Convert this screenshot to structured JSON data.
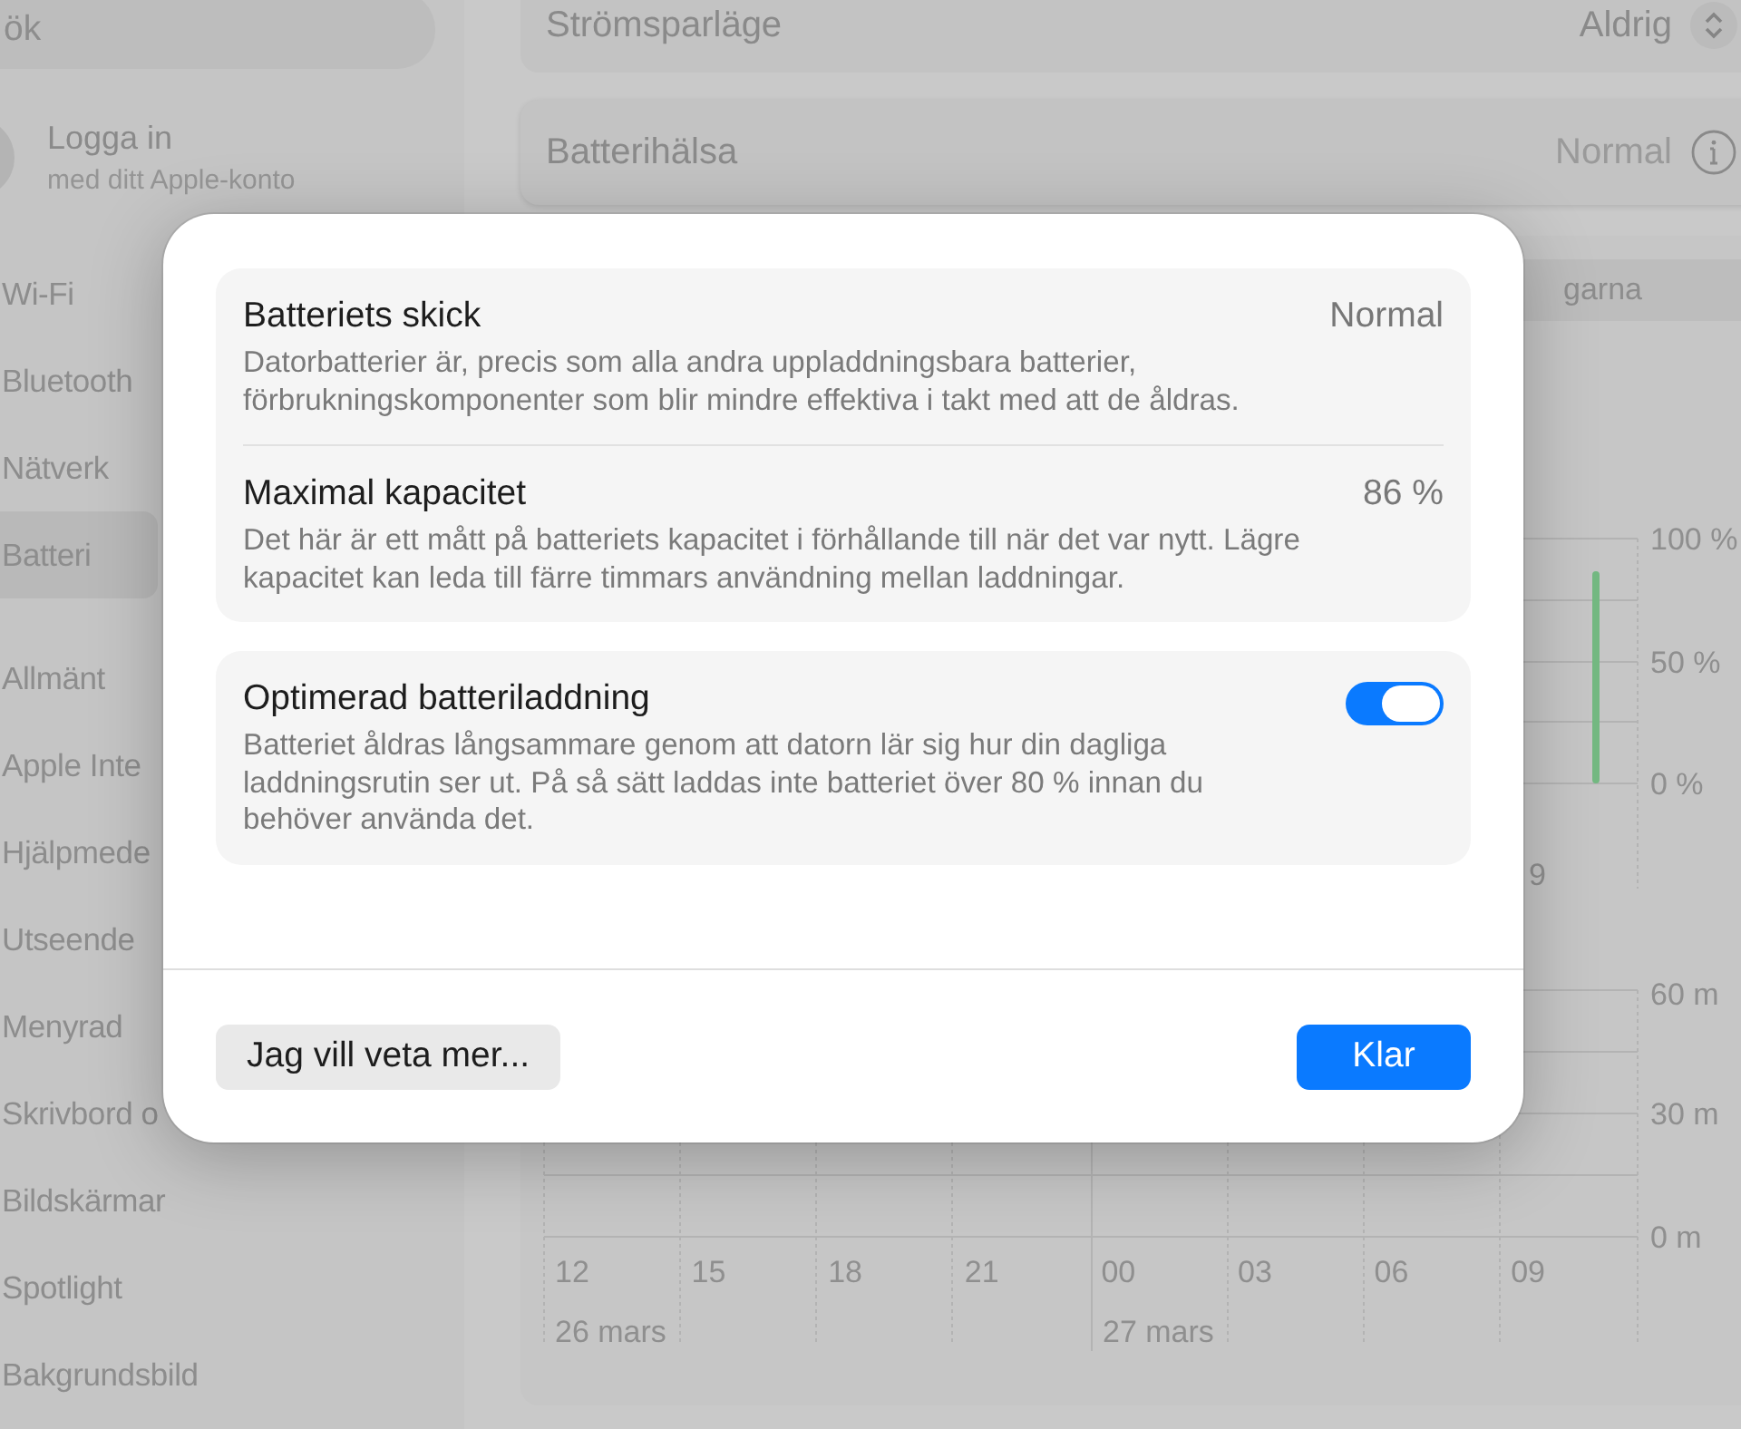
{
  "sidebar": {
    "search": {
      "placeholder": "ök"
    },
    "account": {
      "title": "Logga in",
      "subtitle": "med ditt Apple-konto"
    },
    "groups": [
      [
        {
          "label": "Wi-Fi",
          "selected": false
        },
        {
          "label": "Bluetooth",
          "selected": false
        },
        {
          "label": "Nätverk",
          "selected": false
        },
        {
          "label": "Batteri",
          "selected": true
        }
      ],
      [
        {
          "label": "Allmänt",
          "selected": false
        },
        {
          "label": "Apple Inte",
          "selected": false
        },
        {
          "label": "Hjälpmede",
          "selected": false
        },
        {
          "label": "Utseende",
          "selected": false
        },
        {
          "label": "Menyrad",
          "selected": false
        },
        {
          "label": "Skrivbord o",
          "selected": false
        },
        {
          "label": "Bildskärmar",
          "selected": false
        },
        {
          "label": "Spotlight",
          "selected": false
        },
        {
          "label": "Bakgrundsbild",
          "selected": false
        }
      ]
    ]
  },
  "main": {
    "rows": [
      {
        "label": "Strömsparläge",
        "value": "Aldrig",
        "kind": "popup"
      },
      {
        "label": "Batterihälsa",
        "value": "Normal",
        "kind": "info"
      }
    ],
    "segment": {
      "label": "garna"
    },
    "charts": [
      {
        "y_ticks": [
          "100 %",
          "50 %",
          "0 %"
        ],
        "x_labels": [
          "9"
        ]
      },
      {
        "y_ticks": [
          "60 m",
          "30 m",
          "0 m"
        ],
        "x_labels": [
          "12",
          "15",
          "18",
          "21",
          "00",
          "03",
          "06",
          "09"
        ],
        "dates": [
          "26 mars",
          "27 mars"
        ]
      }
    ]
  },
  "dialog": {
    "cards": [
      {
        "items": [
          {
            "kind": "value",
            "title": "Batteriets skick",
            "value": "Normal",
            "description": "Datorbatterier är, precis som alla andra uppladdningsbara batterier, förbrukningskomponenter som blir mindre effektiva i takt med att de åldras."
          },
          {
            "kind": "value",
            "title": "Maximal kapacitet",
            "value": "86 %",
            "description": "Det här är ett mått på batteriets kapacitet i förhållande till när det var nytt. Lägre kapacitet kan leda till färre timmars användning mellan laddningar."
          }
        ]
      },
      {
        "items": [
          {
            "kind": "toggle",
            "title": "Optimerad batteriladdning",
            "on": true,
            "description": "Batteriet åldras långsammare genom att datorn lär sig hur din dagliga laddningsrutin ser ut. På så sätt laddas inte batteriet över 80 % innan du behöver använda det."
          }
        ]
      }
    ],
    "buttons": [
      {
        "label": "Jag vill veta mer...",
        "kind": "secondary"
      },
      {
        "label": "Klar",
        "kind": "primary"
      }
    ]
  }
}
